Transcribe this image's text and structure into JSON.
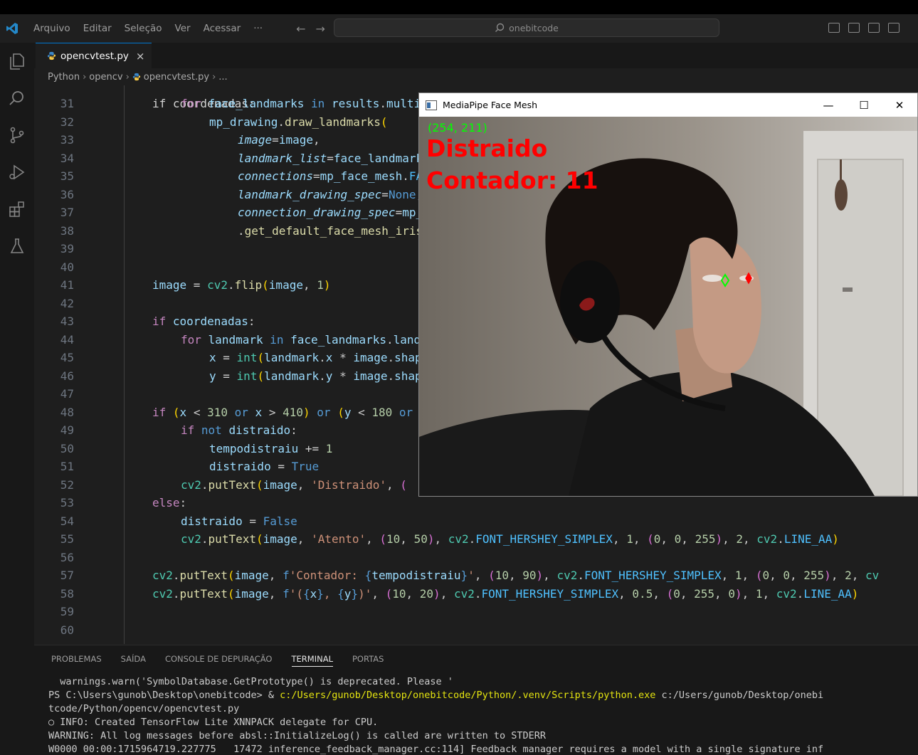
{
  "menu": [
    "Arquivo",
    "Editar",
    "Seleção",
    "Ver",
    "Acessar",
    "···"
  ],
  "search": {
    "text": "onebitcode"
  },
  "tab": {
    "filename": "opencvtest.py",
    "close": "×"
  },
  "breadcrumb": {
    "p1": "Python",
    "p2": "opencv",
    "p3": "opencvtest.py",
    "p4": "..."
  },
  "editor": {
    "partial_line": "if coordenadas:",
    "line_numbers": [
      "31",
      "32",
      "33",
      "34",
      "35",
      "36",
      "37",
      "38",
      "39",
      "40",
      "41",
      "42",
      "43",
      "44",
      "45",
      "46",
      "47",
      "48",
      "49",
      "50",
      "51",
      "52",
      "53",
      "54",
      "55",
      "56",
      "57",
      "58",
      "59",
      "60"
    ]
  },
  "panel": {
    "tabs": [
      "PROBLEMAS",
      "SAÍDA",
      "CONSOLE DE DEPURAÇÃO",
      "TERMINAL",
      "PORTAS"
    ],
    "active_tab": "TERMINAL",
    "terminal": [
      "  warnings.warn('SymbolDatabase.GetPrototype() is deprecated. Please '",
      "PS C:\\Users\\gunob\\Desktop\\onebitcode> & ",
      "c:/Users/gunob/Desktop/onebitcode/Python/.venv/Scripts/python.exe",
      " c:/Users/gunob/Desktop/onebi",
      "tcode/Python/opencv/opencvtest.py",
      "○ INFO: Created TensorFlow Lite XNNPACK delegate for CPU.",
      "WARNING: All log messages before absl::InitializeLog() is called are written to STDERR",
      "W0000 00:00:1715964719.227775   17472 inference_feedback_manager.cc:114] Feedback manager requires a model with a single signature inf"
    ]
  },
  "mediapipe_window": {
    "title": "MediaPipe Face Mesh",
    "coords": "(254, 211)",
    "status": "Distraido",
    "counter": "Contador: 11"
  },
  "colors": {
    "accent": "#0078d4",
    "overlay_red": "#ff0000",
    "overlay_green": "#00ff00"
  }
}
